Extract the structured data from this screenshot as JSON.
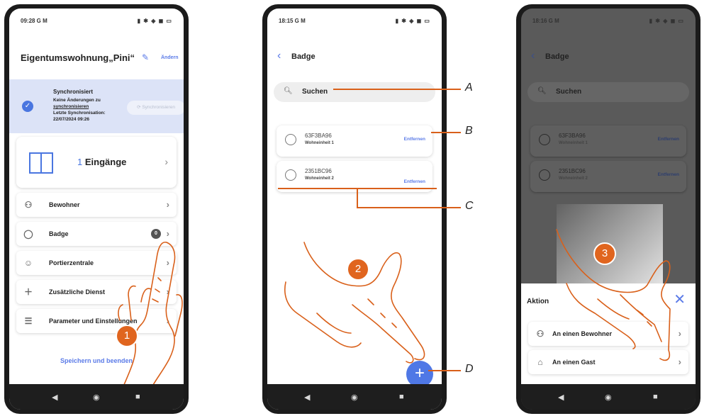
{
  "phone1": {
    "time": "09:28 G M",
    "status_icons": "▮ ✱ ◈ ◼ ▭",
    "title": "Eigentumswohnung„Pini“",
    "edit_link": "Ändern",
    "sync": {
      "heading": "Synchronisiert",
      "line1": "Keine Änderungen zu",
      "line2": "synchronisieren",
      "line3": "Letzte Synchronisation:",
      "line4": "22/07/2024 09:26",
      "button": "Synchronisieren"
    },
    "entrance": {
      "count": "1",
      "label": "Eingänge"
    },
    "menu": [
      {
        "label": "Bewohner",
        "icon": "person-icon"
      },
      {
        "label": "Badge",
        "icon": "badge-icon",
        "count": "0"
      },
      {
        "label": "Portierzentrale",
        "icon": "concierge-icon"
      },
      {
        "label": "Zusätzliche Dienst",
        "icon": "plus-icon"
      },
      {
        "label": "Parameter und Einstellungen",
        "icon": "sliders-icon"
      }
    ],
    "save_link": "Speichern und beenden",
    "step": "1"
  },
  "phone2": {
    "time": "18:15 G M",
    "title": "Badge",
    "search_placeholder": "Suchen",
    "badges": [
      {
        "code": "63F3BA96",
        "unit": "Wohneinheit 1",
        "action": "Entfernen"
      },
      {
        "code": "2351BC96",
        "unit": "Wohneinheit 2",
        "action": "Entfernen"
      }
    ],
    "add_symbol": "+",
    "step": "2"
  },
  "phone3": {
    "time": "18:16 G M",
    "title": "Badge",
    "search_placeholder": "Suchen",
    "badges": [
      {
        "code": "63F3BA96",
        "unit": "Wohneinheit 1",
        "action": "Entfernen"
      },
      {
        "code": "2351BC96",
        "unit": "Wohneinheit 2",
        "action": "Entfernen"
      }
    ],
    "sheet_title": "Aktion",
    "actions": [
      {
        "label": "An einen Bewohner",
        "icon": "person-icon"
      },
      {
        "label": "An einen Gast",
        "icon": "guest-icon"
      }
    ],
    "step": "3"
  },
  "callouts": {
    "a": "A",
    "b": "B",
    "c": "C",
    "d": "D"
  },
  "colors": {
    "accent": "#5b7be8",
    "orange": "#e0651f",
    "sync_bg": "#dce3f7"
  }
}
